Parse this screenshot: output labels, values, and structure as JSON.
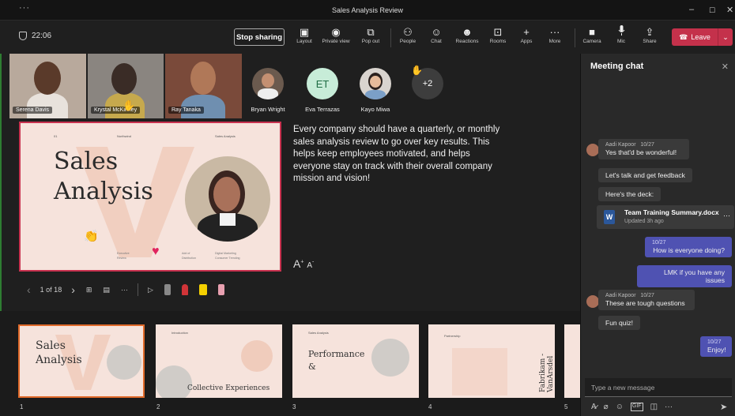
{
  "window": {
    "title": "Sales Analysis Review",
    "menu_dots": "···",
    "minimize": "–",
    "maximize": "☐",
    "close": "✕"
  },
  "toolbar": {
    "timer": "22:06",
    "stop_sharing": "Stop sharing",
    "items": [
      {
        "label": "Layout",
        "icon": "layout-icon",
        "glyph": "▣"
      },
      {
        "label": "Private view",
        "icon": "eye-icon",
        "glyph": "◉"
      },
      {
        "label": "Pop out",
        "icon": "popout-icon",
        "glyph": "⧉"
      },
      {
        "label": "People",
        "icon": "people-icon",
        "glyph": "⚇"
      },
      {
        "label": "Chat",
        "icon": "chat-icon",
        "glyph": "☺"
      },
      {
        "label": "Reactions",
        "icon": "reactions-icon",
        "glyph": "☻"
      },
      {
        "label": "Rooms",
        "icon": "rooms-icon",
        "glyph": "⊡"
      },
      {
        "label": "Apps",
        "icon": "apps-icon",
        "glyph": "+"
      },
      {
        "label": "More",
        "icon": "more-icon",
        "glyph": "···"
      },
      {
        "label": "Camera",
        "icon": "camera-icon",
        "glyph": "■"
      },
      {
        "label": "Mic",
        "icon": "mic-icon",
        "glyph": "🎙"
      },
      {
        "label": "Share",
        "icon": "share-icon",
        "glyph": "⇪"
      }
    ],
    "leave": "Leave",
    "leave_color": "#c4314b"
  },
  "participants": {
    "video": [
      {
        "name": "Serena Davis"
      },
      {
        "name": "Krystal McKinney"
      },
      {
        "name": "Ray Tanaka"
      }
    ],
    "avatars": [
      {
        "name": "Bryan Wright",
        "initials": ""
      },
      {
        "name": "Eva Terrazas",
        "initials": "ET"
      },
      {
        "name": "Kayo Miwa",
        "initials": ""
      }
    ],
    "overflow": "+2"
  },
  "slide": {
    "title_line1": "Sales",
    "title_line2": "Analysis",
    "header_left": "01",
    "header_mid": "Northwind",
    "header_right": "Sales Analysis",
    "footer": [
      "Executive Review",
      "Add of Distribution",
      "Digital Marketing Consumer Trending"
    ],
    "counter": "1 of 18"
  },
  "notes": "Every company should have a quarterly, or monthly sales analysis review to go over key results. This helps keep employees motivated, and helps everyone stay on track with their overall company mission and vision!",
  "font_controls": {
    "increase": "A",
    "decrease": "A"
  },
  "thumbnails": [
    {
      "num": "1",
      "title": "Sales Analysis",
      "sub": ""
    },
    {
      "num": "2",
      "title": "Collective Experiences",
      "sub": "Introduction"
    },
    {
      "num": "3",
      "title": "Performance &",
      "sub": "Sales Analysis"
    },
    {
      "num": "4",
      "title": "Fabrikam - VanArsdel",
      "sub": "Partnership"
    },
    {
      "num": "5",
      "title": "",
      "sub": ""
    }
  ],
  "chat": {
    "title": "Meeting chat",
    "messages": [
      {
        "author": "Aadi Kapoor",
        "time": "10/27",
        "text": "Yes that'd be wonderful!"
      },
      {
        "text": "Let's talk and get feedback"
      },
      {
        "text": "Here's the deck:"
      },
      {
        "time": "10/27",
        "text": "How is everyone doing?",
        "mine": true
      },
      {
        "text": "LMK if you have any issues",
        "mine": true
      },
      {
        "author": "Aadi Kapoor",
        "time": "10/27",
        "text": "These are tough questions"
      },
      {
        "text": "Fun quiz!"
      },
      {
        "time": "10/27",
        "text": "Enjoy!",
        "mine": true
      }
    ],
    "file": {
      "name": "Team Training Summary.docx",
      "updated": "Updated 3h ago",
      "more": "···"
    },
    "input_placeholder": "Type a new message"
  },
  "colors": {
    "accent": "#4f52b2",
    "slide_bg": "#f6e3dc",
    "slide_border": "#c8324f"
  }
}
